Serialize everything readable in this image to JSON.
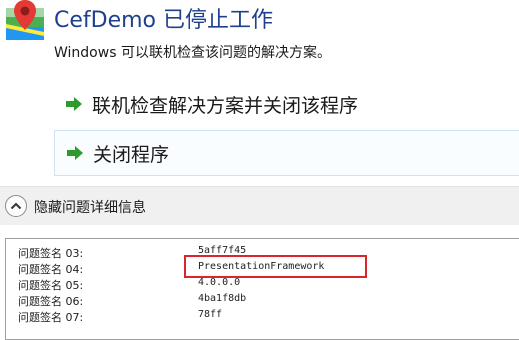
{
  "dialog": {
    "title": "CefDemo 已停止工作",
    "subtitle": "Windows 可以联机检查该问题的解决方案。",
    "options": [
      {
        "label": "联机检查解决方案并关闭该程序"
      },
      {
        "label": "关闭程序"
      }
    ],
    "details_toggle_label": "隐藏问题详细信息",
    "details": [
      {
        "key": "问题签名 03:",
        "value": "5aff7f45"
      },
      {
        "key": "问题签名 04:",
        "value": "PresentationFramework"
      },
      {
        "key": "问题签名 05:",
        "value": "4.0.0.0"
      },
      {
        "key": "问题签名 06:",
        "value": "4ba1f8db"
      },
      {
        "key": "问题签名 07:",
        "value": "78ff"
      }
    ]
  },
  "colors": {
    "title": "#1f3f8f",
    "arrow": "#2e9a2e",
    "highlight": "#d9262a"
  },
  "icons": {
    "app": "maps-pin-icon",
    "arrow": "green-right-arrow-icon",
    "toggle": "chevron-up-icon"
  }
}
